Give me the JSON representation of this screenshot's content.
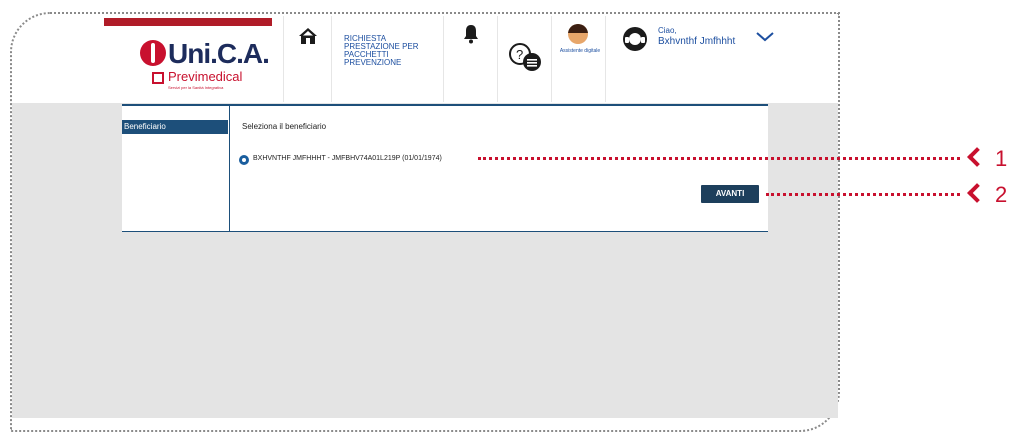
{
  "header": {
    "logo_brand": "Uni.C.A.",
    "logo_sub": "Previmedical",
    "logo_tagline": "Servizi per la Sanità Integrativa",
    "request_title": "RICHIESTA PRESTAZIONE PER PACCHETTI PREVENZIONE",
    "assistant_label": "Assistente digitale",
    "greeting": "Ciao,",
    "user_name": "Bxhvnthf Jmfhhht"
  },
  "sidebar": {
    "items": [
      {
        "label": "Beneficiario"
      }
    ]
  },
  "main": {
    "select_label": "Seleziona il beneficiario",
    "beneficiary_option": "BXHVNTHF JMFHHHT - JMFBHV74A01L219P (01/01/1974)",
    "next_button": "AVANTI"
  },
  "annotations": {
    "callout_1": "1",
    "callout_2": "2"
  },
  "colors": {
    "accent": "#1d4f7a",
    "brand_red": "#c8102e",
    "link_blue": "#1d4fa0"
  },
  "icons": [
    "home-icon",
    "bell-icon",
    "faq-icon",
    "assistant-avatar",
    "user-icon",
    "chevron-down-icon",
    "radio-selected-icon"
  ]
}
